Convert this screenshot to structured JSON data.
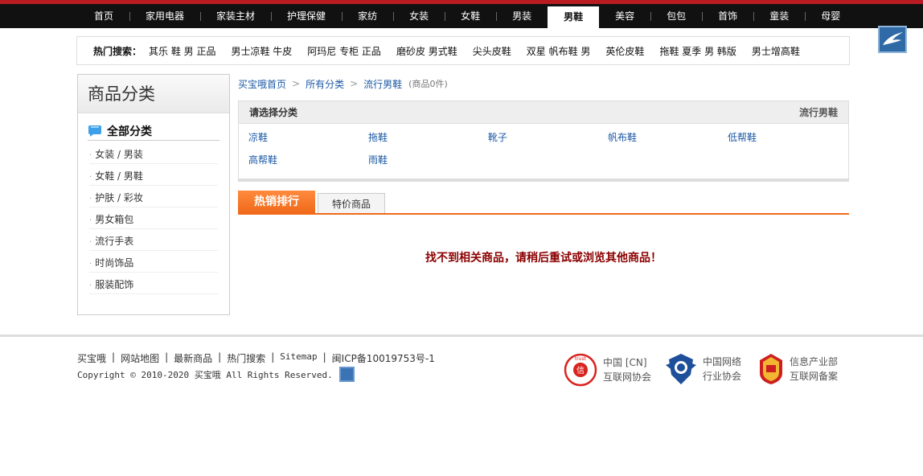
{
  "topnav": {
    "items": [
      "首页",
      "家用电器",
      "家装主材",
      "护理保健",
      "家纺",
      "女装",
      "女鞋",
      "男装",
      "男鞋",
      "美容",
      "包包",
      "首饰",
      "童装",
      "母婴"
    ],
    "active": "男鞋"
  },
  "hotsearch": {
    "label": "热门搜索：",
    "items": [
      "其乐 鞋 男 正品",
      "男士凉鞋 牛皮",
      "阿玛尼 专柜 正品",
      "磨砂皮 男式鞋",
      "尖头皮鞋",
      "双星 帆布鞋 男",
      "英伦皮鞋",
      "拖鞋 夏季 男 韩版",
      "男士增高鞋"
    ]
  },
  "sidebar": {
    "title": "商品分类",
    "subhead": "全部分类",
    "items": [
      "女装 / 男装",
      "女鞋 / 男鞋",
      "护肤 / 彩妆",
      "男女箱包",
      "流行手表",
      "时尚饰品",
      "服装配饰"
    ]
  },
  "breadcrumb": {
    "items": [
      "买宝哦首页",
      "所有分类",
      "流行男鞋"
    ],
    "count": "(商品0件)"
  },
  "catbox": {
    "title": "请选择分类",
    "right": "流行男鞋",
    "links": [
      "凉鞋",
      "拖鞋",
      "靴子",
      "帆布鞋",
      "低帮鞋",
      "高帮鞋",
      "雨鞋"
    ]
  },
  "tabs": {
    "active": "热销排行",
    "other": "特价商品"
  },
  "empty_message": "找不到相关商品，请稍后重试或浏览其他商品！",
  "footer": {
    "links": [
      "买宝哦",
      "网站地图",
      "最新商品",
      "热门搜索",
      "Sitemap",
      "闽ICP备10019753号-1"
    ],
    "copyright": "Copyright © 2010-2020 买宝哦 All Rights Reserved.",
    "badges": [
      {
        "line1": "中国 [CN]",
        "line2": "互联网协会",
        "icon": "trust-seal-icon",
        "color": "#d9231f"
      },
      {
        "line1": "中国网络",
        "line2": "行业协会",
        "icon": "police-badge-icon",
        "color": "#1d4f9a"
      },
      {
        "line1": "信息产业部",
        "line2": "互联网备案",
        "icon": "emblem-icon",
        "color": "#cc1f1f"
      }
    ]
  },
  "colors": {
    "topbar": "#111111",
    "topbar_accent": "#b81c22",
    "link": "#1d5aa5",
    "tab_accent": "#f06a1a",
    "empty_message": "#8b0000"
  }
}
